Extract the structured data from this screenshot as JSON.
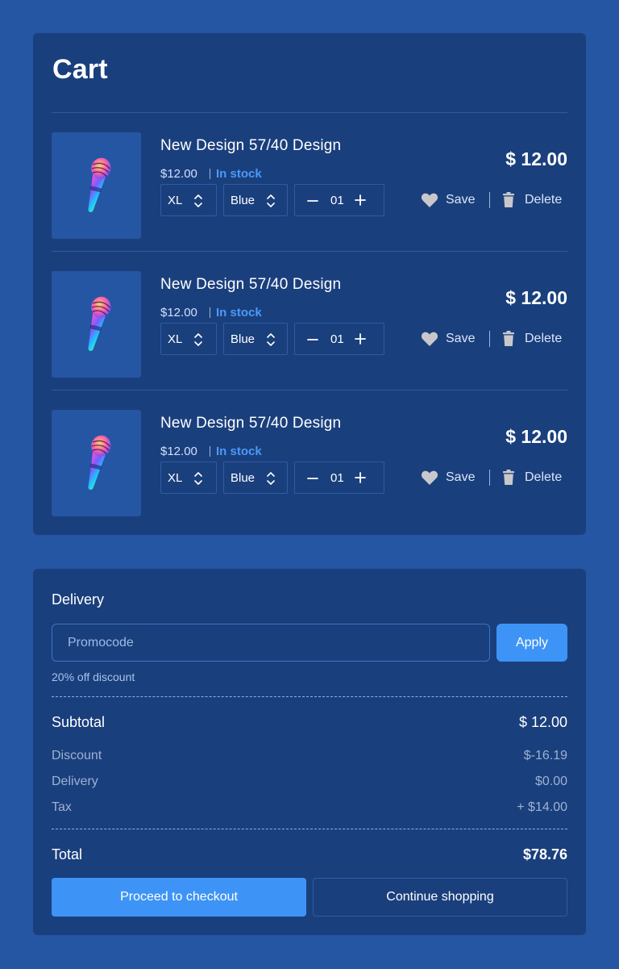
{
  "cart": {
    "title": "Cart",
    "items": [
      {
        "name": "New Design 57/40 Design",
        "unit_price": "$12.00",
        "stock": "In stock",
        "price": "$ 12.00",
        "size": "XL",
        "color": "Blue",
        "quantity": "01",
        "save_label": "Save",
        "delete_label": "Delete",
        "image_icon": "microphone-icon"
      },
      {
        "name": "New Design 57/40 Design",
        "unit_price": "$12.00",
        "stock": "In stock",
        "price": "$ 12.00",
        "size": "XL",
        "color": "Blue",
        "quantity": "01",
        "save_label": "Save",
        "delete_label": "Delete",
        "image_icon": "microphone-icon"
      },
      {
        "name": "New Design 57/40 Design",
        "unit_price": "$12.00",
        "stock": "In stock",
        "price": "$ 12.00",
        "size": "XL",
        "color": "Blue",
        "quantity": "01",
        "save_label": "Save",
        "delete_label": "Delete",
        "image_icon": "microphone-icon"
      }
    ]
  },
  "summary": {
    "delivery_label": "Delivery",
    "promo_placeholder": "Promocode",
    "apply_label": "Apply",
    "promo_note": "20% off discount",
    "subtotal_label": "Subtotal",
    "subtotal_value": "$ 12.00",
    "discount_label": "Discount",
    "discount_value": "$-16.19",
    "delivery_cost_label": "Delivery",
    "delivery_cost_value": "$0.00",
    "tax_label": "Tax",
    "tax_value": "+ $14.00",
    "total_label": "Total",
    "total_value": "$78.76",
    "checkout_label": "Proceed to checkout",
    "continue_label": "Continue shopping"
  },
  "colors": {
    "background": "#2556a3",
    "panel": "#1a3f7d",
    "accent": "#3d94f6",
    "stock": "#4b9af7"
  }
}
